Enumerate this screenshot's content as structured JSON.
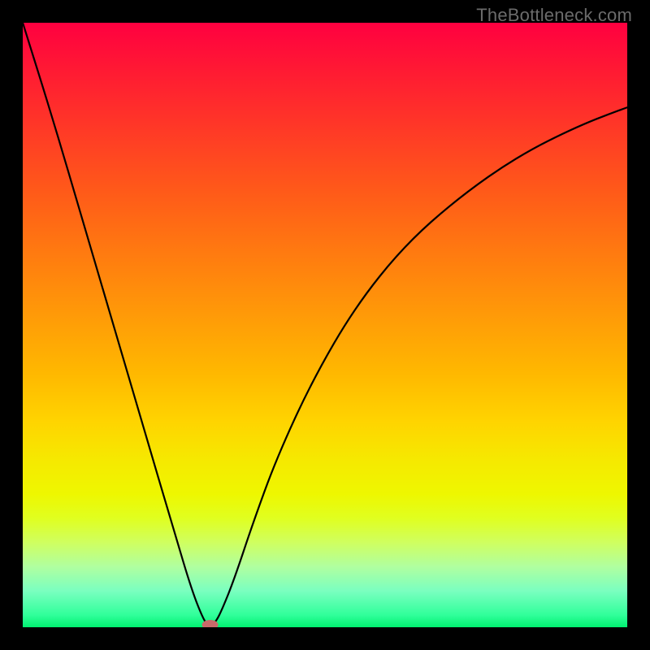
{
  "watermark": "TheBottleneck.com",
  "chart_data": {
    "type": "line",
    "title": "",
    "xlabel": "",
    "ylabel": "",
    "xlim": [
      0,
      100
    ],
    "ylim": [
      0,
      100
    ],
    "grid": false,
    "legend": false,
    "background_gradient": {
      "direction": "vertical",
      "stops": [
        {
          "pos": 0.0,
          "color": "#ff0040"
        },
        {
          "pos": 0.5,
          "color": "#ffa800"
        },
        {
          "pos": 0.75,
          "color": "#fff000"
        },
        {
          "pos": 1.0,
          "color": "#00f070"
        }
      ]
    },
    "series": [
      {
        "name": "bottleneck-curve",
        "color": "#000000",
        "x": [
          0,
          5,
          10,
          15,
          20,
          25,
          28,
          30,
          31,
          32,
          33,
          35,
          38,
          42,
          48,
          55,
          63,
          72,
          82,
          92,
          100
        ],
        "values": [
          100,
          84,
          67,
          50,
          33,
          16,
          6,
          1,
          0,
          1,
          3,
          8,
          17,
          28,
          41,
          53,
          63,
          71,
          78,
          83,
          86
        ]
      }
    ],
    "marker": {
      "name": "optimal-point",
      "x": 31,
      "y": 0,
      "color": "#c96a6a",
      "shape": "ellipse"
    }
  }
}
